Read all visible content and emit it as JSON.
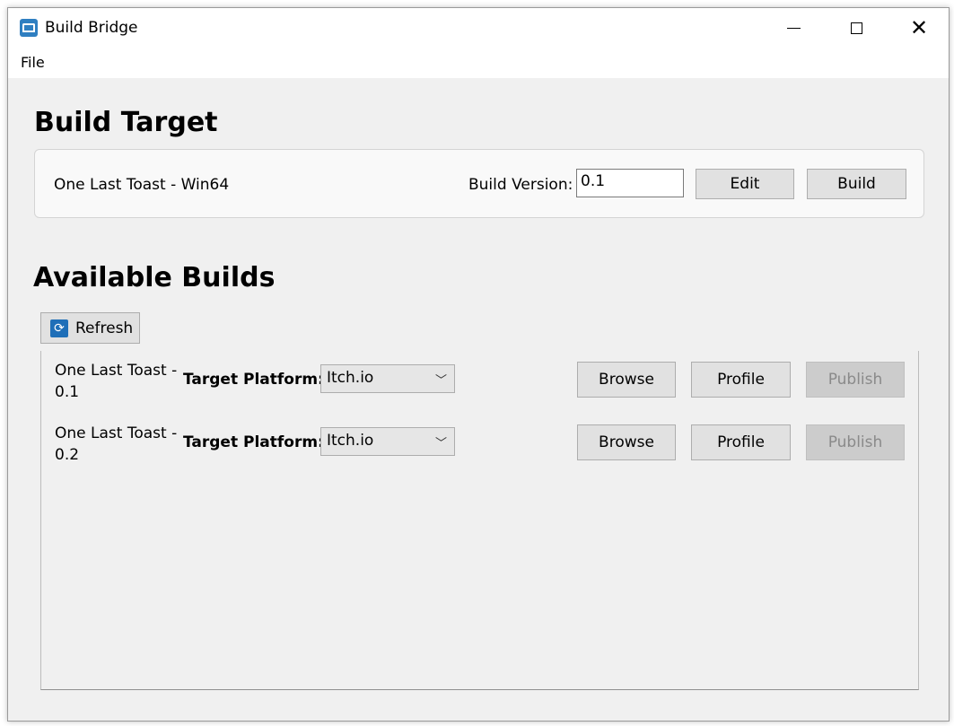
{
  "window": {
    "title": "Build Bridge"
  },
  "menu": {
    "file": "File"
  },
  "build_target": {
    "heading": "Build Target",
    "target_name": "One Last Toast - Win64",
    "version_label": "Build Version:",
    "version_value": "0.1",
    "edit_label": "Edit",
    "build_label": "Build"
  },
  "available_builds": {
    "heading": "Available Builds",
    "refresh_label": "Refresh",
    "rows": [
      {
        "name": "One Last Toast -\n0.1",
        "platform_label": "Target Platform:",
        "platform_value": "Itch.io",
        "browse_label": "Browse",
        "profile_label": "Profile",
        "publish_label": "Publish",
        "publish_enabled": false
      },
      {
        "name": "One Last Toast -\n0.2",
        "platform_label": "Target Platform:",
        "platform_value": "Itch.io",
        "browse_label": "Browse",
        "profile_label": "Profile",
        "publish_label": "Publish",
        "publish_enabled": false
      }
    ]
  },
  "icons": {
    "app": "build-bridge-app-icon",
    "refresh": "refresh-icon",
    "dropdown": "chevron-down-icon"
  },
  "colors": {
    "accent": "#2f7fc1",
    "button_bg": "#e1e1e1",
    "disabled_text": "#8a8a8a"
  }
}
